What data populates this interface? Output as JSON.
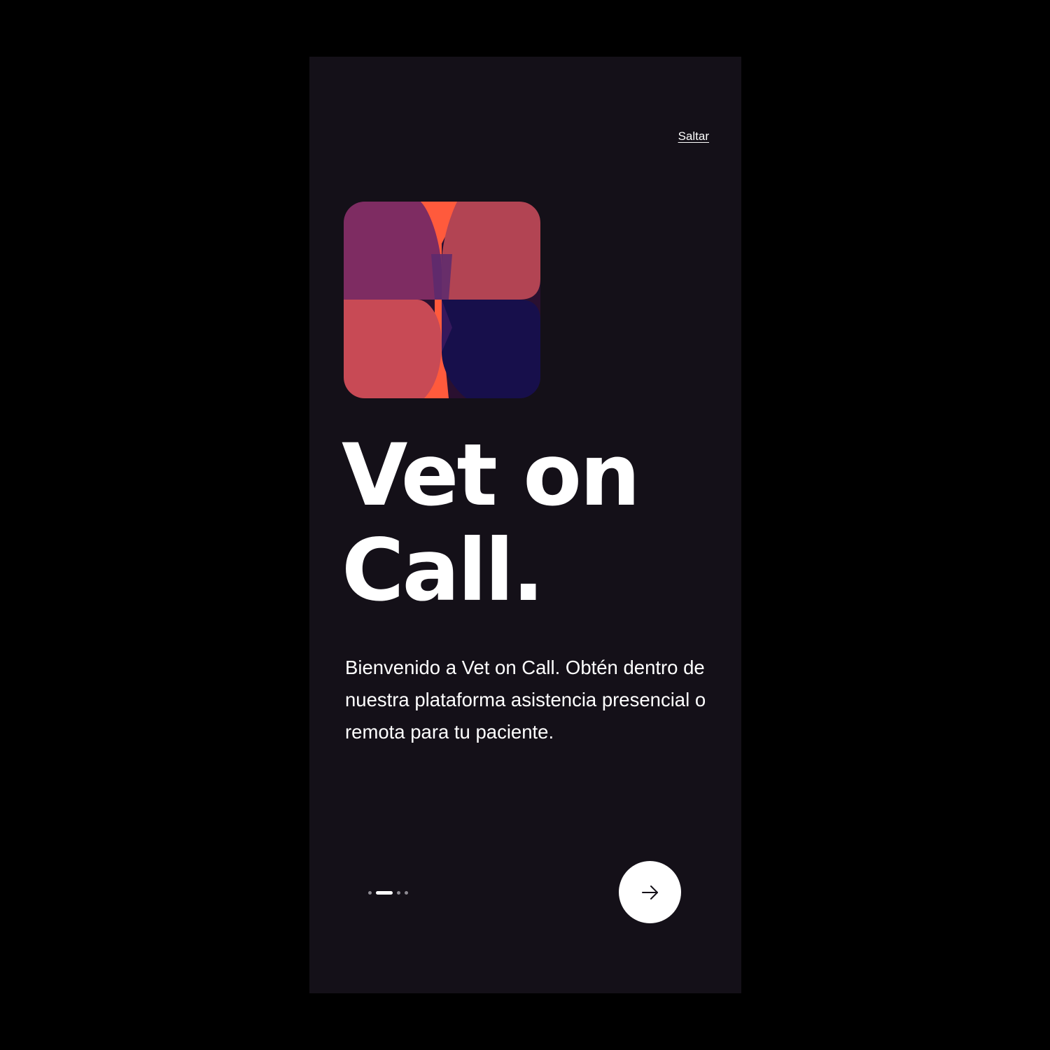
{
  "app": {
    "background_color": "#141018",
    "accent_colors": [
      "#7e2c62",
      "#b24453",
      "#ff5a3c",
      "#170f4b"
    ]
  },
  "header": {
    "skip_label": "Saltar"
  },
  "logo": {
    "icon": "vet-on-call-logo-icon"
  },
  "hero": {
    "title_line1": "Vet on",
    "title_line2": "Call.",
    "description": "Bienvenido a Vet on Call. Obtén dentro de nuestra plataforma asistencia presencial o remota para tu paciente."
  },
  "pager": {
    "total_pages": 4,
    "current_page": 2
  },
  "footer": {
    "next_icon": "arrow-right-icon"
  }
}
